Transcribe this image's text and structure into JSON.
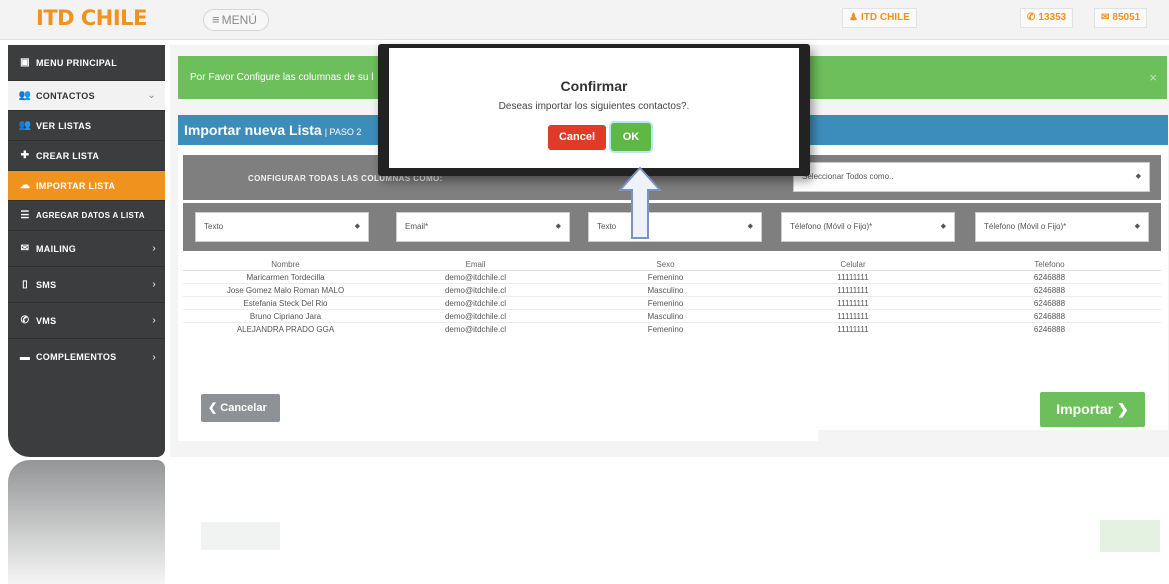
{
  "header": {
    "logo": "ITD CHILE",
    "menu_label": "MENÚ",
    "account_label": "ITD CHILE",
    "phone_count": "13353",
    "mail_count": "85051",
    "accent_color": "#f0921e"
  },
  "sidebar": {
    "items": [
      {
        "label": "MENU PRINCIPAL",
        "icon": "briefcase-icon"
      },
      {
        "label": "CONTACTOS",
        "icon": "users-icon"
      },
      {
        "label": "VER LISTAS",
        "icon": "users-icon"
      },
      {
        "label": "CREAR LISTA",
        "icon": "user-plus-icon"
      },
      {
        "label": "IMPORTAR LISTA",
        "icon": "cloud-upload-icon"
      },
      {
        "label": "AGREGAR DATOS A LISTA",
        "icon": "list-plus-icon"
      },
      {
        "label": "MAILING",
        "icon": "envelope-icon"
      },
      {
        "label": "SMS",
        "icon": "mobile-icon"
      },
      {
        "label": "VMS",
        "icon": "phone-icon"
      },
      {
        "label": "COMPLEMENTOS",
        "icon": "comment-icon"
      }
    ]
  },
  "alert": {
    "text": "Por Favor Configure las columnas de su l"
  },
  "panel": {
    "title": "Importar nueva Lista",
    "step": "| PASO 2",
    "configure_all_label": "CONFIGURAR TODAS LAS COLUMNAS COMO:",
    "select_all_placeholder": "Seleccionar Todos como..",
    "column_selects": [
      "Texto",
      "Email*",
      "Texto",
      "Télefono (Móvil o Fijo)*",
      "Télefono (Móvil o Fijo)*"
    ]
  },
  "table": {
    "headers": [
      "Nombre",
      "Email",
      "Sexo",
      "Celular",
      "Telefono"
    ],
    "rows": [
      [
        "Maricarmen Tordecilla",
        "demo@itdchile.cl",
        "Femenino",
        "11111111",
        "6246888"
      ],
      [
        "Jose Gomez Malo Roman MALO",
        "demo@itdchile.cl",
        "Masculino",
        "11111111",
        "6246888"
      ],
      [
        "Estefania Steck Del Rio",
        "demo@itdchile.cl",
        "Femenino",
        "11111111",
        "6246888"
      ],
      [
        "Bruno Cipriano Jara",
        "demo@itdchile.cl",
        "Masculino",
        "11111111",
        "6246888"
      ],
      [
        "ALEJANDRA PRADO GGA",
        "demo@itdchile.cl",
        "Femenino",
        "11111111",
        "6246888"
      ]
    ]
  },
  "buttons": {
    "cancel": "Cancelar",
    "import": "Importar"
  },
  "modal": {
    "title": "Confirmar",
    "message": "Deseas importar los siguientes contactos?.",
    "cancel_label": "Cancel",
    "ok_label": "OK"
  }
}
